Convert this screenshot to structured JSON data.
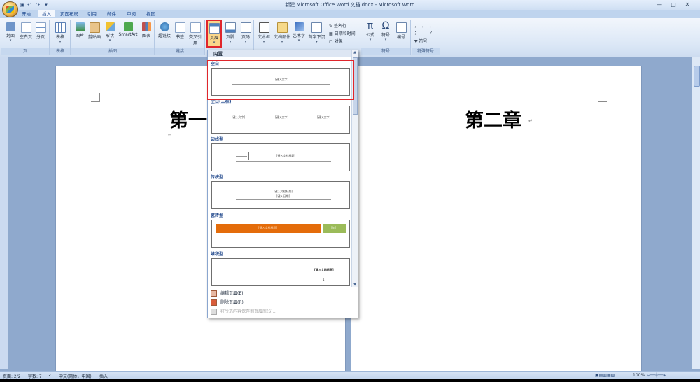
{
  "window": {
    "title": "新建 Microsoft Office Word 文档.docx - Microsoft Word",
    "controls": [
      "—",
      "□",
      "✕"
    ]
  },
  "tabs": [
    "开始",
    "插入",
    "页面布局",
    "引用",
    "邮件",
    "审阅",
    "视图"
  ],
  "active_tab": "插入",
  "ribbon": {
    "groups": {
      "pages": {
        "label": "页",
        "buttons": [
          "封面",
          "空白页",
          "分页"
        ]
      },
      "tables": {
        "label": "表格",
        "buttons": [
          "表格"
        ]
      },
      "illustrations": {
        "label": "插图",
        "buttons": [
          "图片",
          "剪贴画",
          "形状",
          "SmartArt",
          "图表"
        ]
      },
      "links": {
        "label": "链接",
        "buttons": [
          "超链接",
          "书签",
          "交叉引用"
        ]
      },
      "header_footer": {
        "buttons": [
          "页眉",
          "页脚",
          "页码"
        ]
      },
      "text": {
        "buttons": [
          "文本框",
          "文档部件",
          "艺术字",
          "首字下沉"
        ],
        "small": [
          "签名行",
          "日期和时间",
          "对象"
        ]
      },
      "symbols": {
        "label": "符号",
        "buttons": [
          "公式",
          "符号",
          "编号"
        ]
      },
      "special": {
        "label": "特殊符号",
        "items": [
          "，",
          "。",
          "、",
          "；",
          "：",
          "？"
        ],
        "symbol_label": "符号"
      }
    }
  },
  "document": {
    "page1_heading": "第一",
    "page2_heading": "第二章",
    "para_mark": "↵"
  },
  "gallery": {
    "header": "内置",
    "items": [
      {
        "label": "空白",
        "preview": "[键入文字]"
      },
      {
        "label": "空白(三栏)",
        "preview": "[键入文字]"
      },
      {
        "label": "边线型",
        "preview": "[键入文档标题]"
      },
      {
        "label": "传统型",
        "preview": "[键入文档标题]",
        "preview2": "[键入日期]"
      },
      {
        "label": "瓷砖型",
        "preview": "[键入文档标题]",
        "preview2": "[年]"
      },
      {
        "label": "堆积型",
        "preview": "[键入文档标题]",
        "preview2": "1"
      }
    ],
    "menu": [
      {
        "label": "编辑页眉(E)",
        "enabled": true
      },
      {
        "label": "删除页眉(R)",
        "enabled": true
      },
      {
        "label": "将所选内容保存到页眉库(S)...",
        "enabled": false
      }
    ]
  },
  "statusbar": {
    "page": "页面: 2/2",
    "words": "字数: 7",
    "language": "中文(简体，中国)",
    "mode": "插入",
    "zoom": "100%"
  },
  "watermark": {
    "brand": "Bai经验",
    "url": "jingyan.baidu.com"
  },
  "colors": {
    "tile_orange": "#e46c0a",
    "tile_green": "#9bbb59",
    "highlight_red": "#e0262c"
  }
}
